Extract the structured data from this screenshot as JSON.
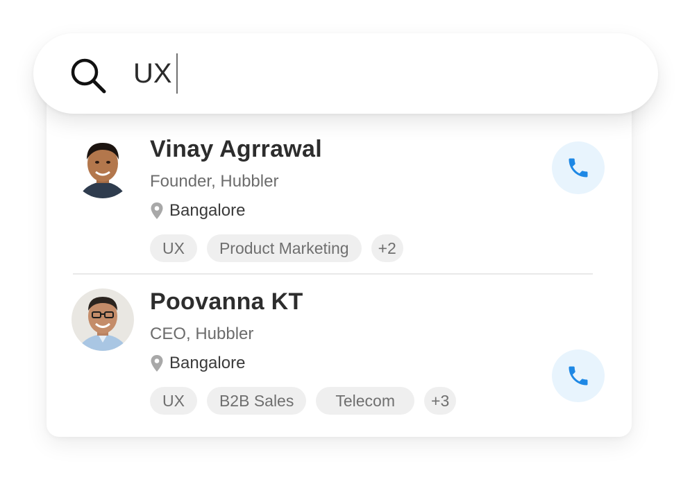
{
  "search": {
    "query": "UX"
  },
  "results": [
    {
      "name": "Vinay Agrrawal",
      "role": "Founder, Hubbler",
      "location": "Bangalore",
      "tags": [
        "UX",
        "Product Marketing"
      ],
      "more_tags": "+2"
    },
    {
      "name": "Poovanna KT",
      "role": "CEO, Hubbler",
      "location": "Bangalore",
      "tags": [
        "UX",
        "B2B Sales",
        "Telecom"
      ],
      "more_tags": "+3"
    }
  ],
  "colors": {
    "accent": "#1e88e5",
    "call_button_bg": "#e8f4fd",
    "tag_bg": "#efefef",
    "text_primary": "#2d2d2d",
    "text_secondary": "#6c6c6c"
  },
  "icons": {
    "search": "search-icon",
    "location": "map-pin-icon",
    "call": "phone-icon"
  }
}
